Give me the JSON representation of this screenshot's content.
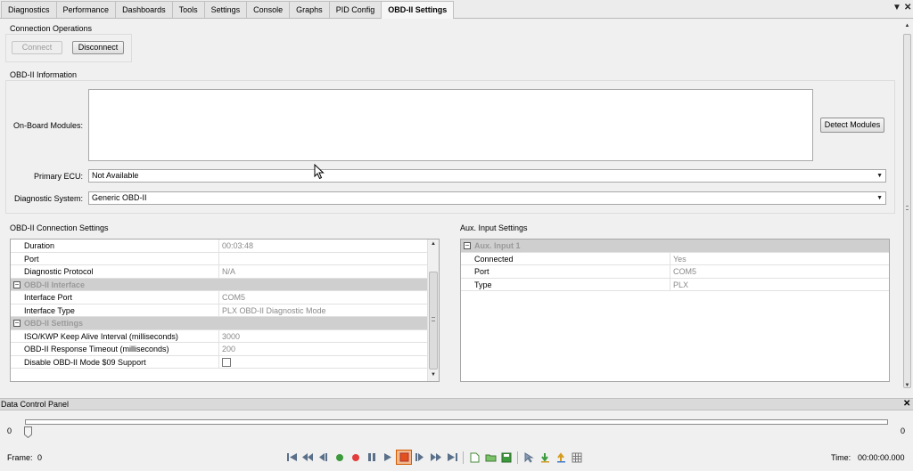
{
  "tabs": [
    {
      "label": "Diagnostics"
    },
    {
      "label": "Performance"
    },
    {
      "label": "Dashboards"
    },
    {
      "label": "Tools"
    },
    {
      "label": "Settings"
    },
    {
      "label": "Console"
    },
    {
      "label": "Graphs"
    },
    {
      "label": "PID Config"
    },
    {
      "label": "OBD-II Settings",
      "active": true
    }
  ],
  "tab_controls": {
    "menu_glyph": "▼",
    "close_glyph": "✕"
  },
  "connection": {
    "title": "Connection Operations",
    "connect_label": "Connect",
    "disconnect_label": "Disconnect"
  },
  "obd_info": {
    "title": "OBD-II Information",
    "modules_label": "On-Board Modules:",
    "detect_label": "Detect Modules",
    "primary_ecu_label": "Primary ECU:",
    "primary_ecu_value": "Not Available",
    "diag_system_label": "Diagnostic System:",
    "diag_system_value": "Generic OBD-II"
  },
  "conn_settings": {
    "title": "OBD-II Connection Settings",
    "rows": [
      {
        "name": "Duration",
        "value": "00:03:48"
      },
      {
        "name": "Port",
        "value": ""
      },
      {
        "name": "Diagnostic Protocol",
        "value": "N/A"
      },
      {
        "category": "OBD-II Interface"
      },
      {
        "name": "Interface Port",
        "value": "COM5"
      },
      {
        "name": "Interface Type",
        "value": "PLX OBD-II Diagnostic Mode"
      },
      {
        "category": "OBD-II Settings"
      },
      {
        "name": "ISO/KWP Keep Alive Interval (milliseconds)",
        "value": "3000"
      },
      {
        "name": "OBD-II Response Timeout (milliseconds)",
        "value": "200"
      },
      {
        "name": "Disable OBD-II Mode $09 Support",
        "checkbox": true,
        "checked": false
      }
    ]
  },
  "aux_settings": {
    "title": "Aux. Input Settings",
    "rows": [
      {
        "category": "Aux. Input 1"
      },
      {
        "name": "Connected",
        "value": "Yes"
      },
      {
        "name": "Port",
        "value": "COM5"
      },
      {
        "name": "Type",
        "value": "PLX"
      }
    ]
  },
  "data_panel": {
    "title": "Data Control Panel",
    "close_glyph": "✕",
    "slider_min": "0",
    "slider_max": "0",
    "slider_value": 0,
    "frame_label": "Frame:",
    "frame_value": "0",
    "time_label": "Time:",
    "time_value": "00:00:00.000"
  },
  "colors": {
    "play_green": "#3c9a3c",
    "record_red": "#e23c3c",
    "stop_active_bg": "#f2b98d",
    "category_bg": "#cfcfcf"
  }
}
